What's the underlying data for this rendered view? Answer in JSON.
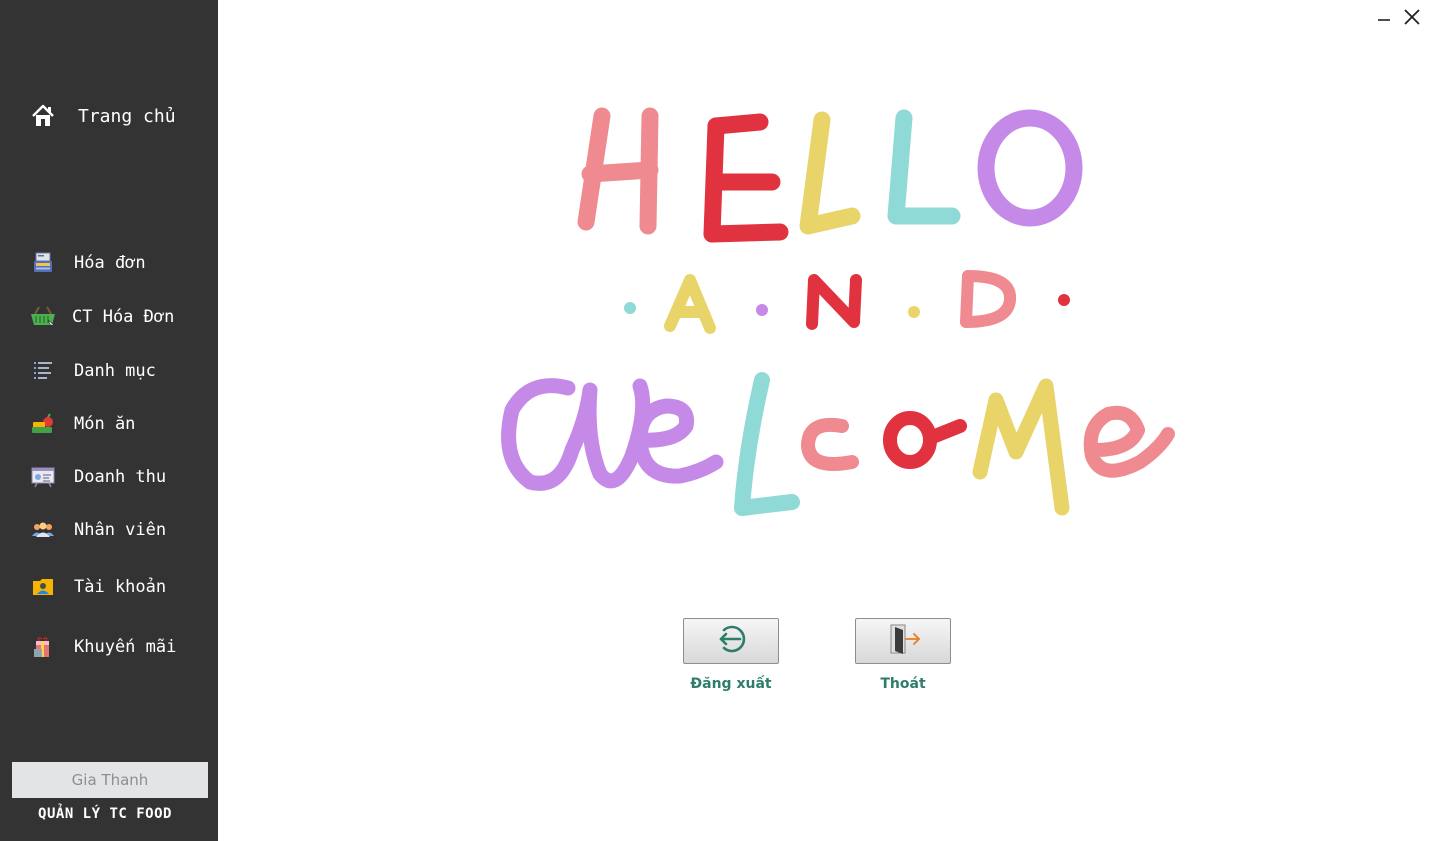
{
  "sidebar": {
    "home_label": "Trang chủ",
    "items": [
      {
        "label": "Hóa đơn",
        "icon": "invoice-register-icon"
      },
      {
        "label": "CT Hóa Đơn",
        "icon": "shopping-basket-icon"
      },
      {
        "label": "Danh mục",
        "icon": "list-icon"
      },
      {
        "label": "Món ăn",
        "icon": "food-icon"
      },
      {
        "label": "Doanh thu",
        "icon": "revenue-board-icon"
      },
      {
        "label": "Nhân viên",
        "icon": "staff-icon"
      },
      {
        "label": "Tài khoản",
        "icon": "account-card-icon"
      },
      {
        "label": "Khuyến mãi",
        "icon": "promotion-gift-icon"
      }
    ],
    "user_name": "Gia Thanh",
    "app_name": "QUẢN LÝ TC FOOD"
  },
  "welcome": {
    "line1": "HELLO",
    "line2": "AND",
    "line3": "Welcome"
  },
  "actions": {
    "logout_label": "Đăng xuất",
    "exit_label": "Thoát"
  },
  "colors": {
    "sidebar_bg": "#333333",
    "accent_text": "#2e7d6c",
    "pink": "#ee8a90",
    "red": "#e0323f",
    "yellow": "#e9d46a",
    "teal": "#8fd9d6",
    "purple": "#c58ae8"
  }
}
